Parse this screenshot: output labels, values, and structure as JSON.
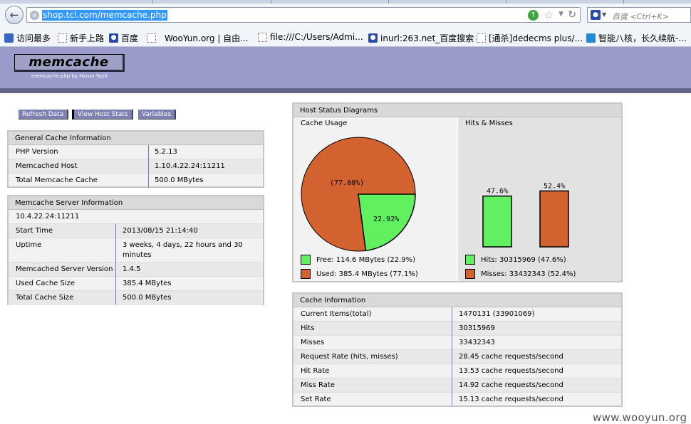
{
  "browser": {
    "url": "shop.tcl.com/memcache.php",
    "search_placeholder": "百度 <Ctrl+K>",
    "bookmarks": [
      {
        "label": "访问最多",
        "icon": "book-icon"
      },
      {
        "label": "新手上路",
        "icon": "page-icon"
      },
      {
        "label": "百度",
        "icon": "baidu-paw-icon"
      },
      {
        "label": "WooYun.org | 自由...",
        "icon": "page-icon"
      },
      {
        "label": "file:///C:/Users/Admi...",
        "icon": "page-icon"
      },
      {
        "label": "inurl:263.net_百度搜索",
        "icon": "baidu-paw-icon"
      },
      {
        "label": "[通杀]dedecms plus/...",
        "icon": "page-icon"
      },
      {
        "label": "智能八核，长久续航-...",
        "icon": "magazine-icon"
      }
    ]
  },
  "app": {
    "logo": "memcache",
    "logo_sub": "memcache.php by Harun Yayli"
  },
  "nav": {
    "refresh": "Refresh Data",
    "host_stats": "View Host Stats",
    "variables": "Variables"
  },
  "general": {
    "title": "General Cache Information",
    "rows": [
      {
        "k": "PHP Version",
        "v": "5.2.13"
      },
      {
        "k": "Memcached Host",
        "v": "1.10.4.22.24:11211"
      },
      {
        "k": "Total Memcache Cache",
        "v": "500.0 MBytes"
      }
    ]
  },
  "server": {
    "title": "Memcache Server Information",
    "host": "10.4.22.24:11211",
    "rows": [
      {
        "k": "Start Time",
        "v": "2013/08/15 21:14:40"
      },
      {
        "k": "Uptime",
        "v": "3 weeks, 4 days, 22 hours and 30 minutes"
      },
      {
        "k": "Memcached Server Version",
        "v": "1.4.5"
      },
      {
        "k": "Used Cache Size",
        "v": "385.4 MBytes"
      },
      {
        "k": "Total Cache Size",
        "v": "500.0 MBytes"
      }
    ]
  },
  "host_status": {
    "title": "Host Status Diagrams",
    "cache_usage_title": "Cache Usage",
    "hits_misses_title": "Hits & Misses",
    "free_legend": "Free: 114.6 MBytes (22.9%)",
    "used_legend": "Used: 385.4 MBytes (77.1%)",
    "hits_legend": "Hits: 30315969 (47.6%)",
    "misses_legend": "Misses: 33432343 (52.4%)"
  },
  "chart_data": [
    {
      "type": "pie",
      "title": "Cache Usage",
      "labels": [
        "Used",
        "Free"
      ],
      "values": [
        77.08,
        22.92
      ],
      "data_labels": [
        "(77.08%)",
        "22.92%"
      ],
      "colors": [
        "#d2622f",
        "#60f060"
      ]
    },
    {
      "type": "bar",
      "title": "Hits & Misses",
      "categories": [
        "Hits",
        "Misses"
      ],
      "values": [
        47.6,
        52.4
      ],
      "data_labels": [
        "47.6%",
        "52.4%"
      ],
      "colors": [
        "#60f060",
        "#d2622f"
      ]
    }
  ],
  "cache_info": {
    "title": "Cache Information",
    "rows": [
      {
        "k": "Current Items(total)",
        "v": "1470131 (33901069)"
      },
      {
        "k": "Hits",
        "v": "30315969"
      },
      {
        "k": "Misses",
        "v": "33432343"
      },
      {
        "k": "Request Rate (hits, misses)",
        "v": "28.45 cache requests/second"
      },
      {
        "k": "Hit Rate",
        "v": "13.53 cache requests/second"
      },
      {
        "k": "Miss Rate",
        "v": "14.92 cache requests/second"
      },
      {
        "k": "Set Rate",
        "v": "15.13 cache requests/second"
      }
    ]
  },
  "watermark": "www.wooyun.org"
}
